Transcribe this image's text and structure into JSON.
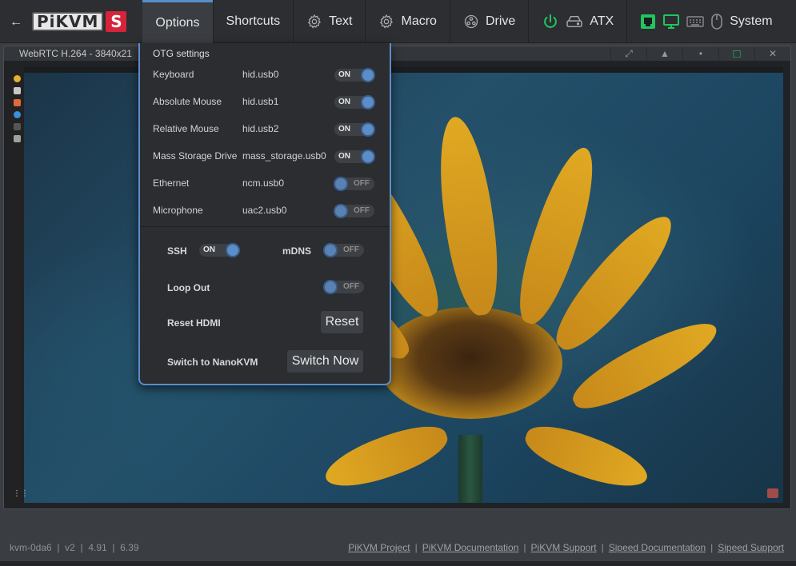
{
  "navbar": {
    "back_label": "←",
    "logo_text": "PiKVM",
    "logo_badge": "S",
    "items": [
      {
        "label": "Options",
        "active": true
      },
      {
        "label": "Shortcuts"
      },
      {
        "label": "Text",
        "icon": "gear-icon"
      },
      {
        "label": "Macro",
        "icon": "gear-icon"
      },
      {
        "label": "Drive",
        "icon": "drive-icon"
      },
      {
        "label": "ATX",
        "icon": "power-icon"
      },
      {
        "label": "System",
        "icon": "mouse-icon"
      }
    ],
    "colors": {
      "accent": "#5b8dc9",
      "power": "#22c55e",
      "logo_badge": "#d6243a"
    }
  },
  "stream": {
    "title": "WebRTC H.264 - 3840x21",
    "buttons": [
      "expand-icon",
      "triangle-icon",
      "dot-icon",
      "square-icon",
      "close-icon"
    ],
    "button_glyphs": [
      "⤢",
      "▲",
      "•",
      "□",
      "✕"
    ]
  },
  "options_menu": {
    "heading": "OTG settings",
    "otg": [
      {
        "name": "Keyboard",
        "device": "hid.usb0",
        "state": "ON"
      },
      {
        "name": "Absolute Mouse",
        "device": "hid.usb1",
        "state": "ON"
      },
      {
        "name": "Relative Mouse",
        "device": "hid.usb2",
        "state": "ON"
      },
      {
        "name": "Mass Storage Drive",
        "device": "mass_storage.usb0",
        "state": "ON"
      },
      {
        "name": "Ethernet",
        "device": "ncm.usb0",
        "state": "OFF"
      },
      {
        "name": "Microphone",
        "device": "uac2.usb0",
        "state": "OFF"
      }
    ],
    "ssh": {
      "label": "SSH",
      "state": "ON"
    },
    "mdns": {
      "label": "mDNS",
      "state": "OFF"
    },
    "loop_out": {
      "label": "Loop Out",
      "state": "OFF"
    },
    "reset_hdmi": {
      "label": "Reset HDMI",
      "button": "Reset"
    },
    "switch_nanokvm": {
      "label": "Switch to NanoKVM",
      "button": "Switch Now"
    }
  },
  "footer": {
    "host": "kvm-0da6",
    "version": "v2",
    "kernel": "4.91",
    "build": "6.39",
    "sep": "|",
    "links": [
      "PiKVM Project",
      "PiKVM Documentation",
      "PiKVM Support",
      "Sipeed Documentation",
      "Sipeed Support"
    ]
  }
}
